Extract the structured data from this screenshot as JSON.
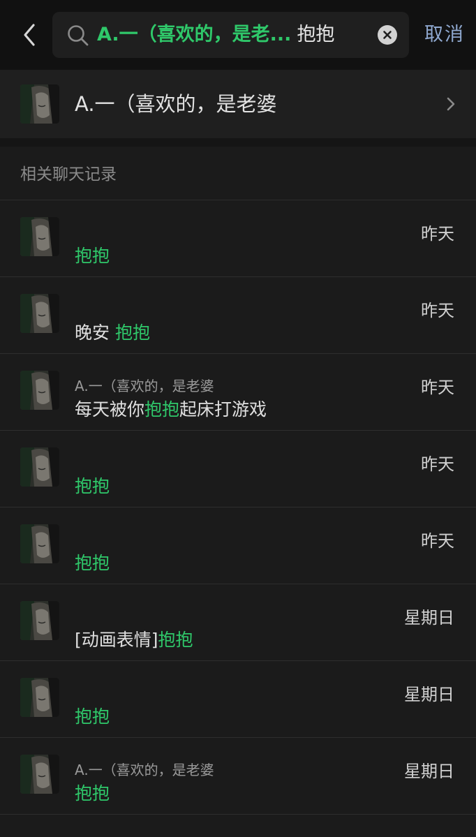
{
  "header": {
    "search_tag": "A.一（喜欢的，是老...",
    "search_term": "抱抱",
    "cancel_label": "取消"
  },
  "contact": {
    "name": "A.一（喜欢的，是老婆"
  },
  "section": {
    "title": "相关聊天记录"
  },
  "messages": [
    {
      "time": "昨天",
      "sender": "",
      "pre": "",
      "hl": "抱抱",
      "post": ""
    },
    {
      "time": "昨天",
      "sender": "",
      "pre": "晚安 ",
      "hl": "抱抱",
      "post": ""
    },
    {
      "time": "昨天",
      "sender": "A.一（喜欢的，是老婆",
      "pre": "每天被你",
      "hl": "抱抱",
      "post": "起床打游戏"
    },
    {
      "time": "昨天",
      "sender": "",
      "pre": "",
      "hl": "抱抱",
      "post": ""
    },
    {
      "time": "昨天",
      "sender": "",
      "pre": "",
      "hl": "抱抱",
      "post": ""
    },
    {
      "time": "星期日",
      "sender": "",
      "pre": "[动画表情]",
      "hl": "抱抱",
      "post": ""
    },
    {
      "time": "星期日",
      "sender": "",
      "pre": "",
      "hl": "抱抱",
      "post": ""
    },
    {
      "time": "星期日",
      "sender": "A.一（喜欢的，是老婆",
      "pre": "",
      "hl": "抱抱",
      "post": ""
    }
  ],
  "colors": {
    "highlight": "#2fc86a",
    "cancel": "#8fa8cf",
    "background": "#1b1b1b"
  },
  "icons": [
    "back-chevron-icon",
    "search-icon",
    "clear-icon",
    "chevron-right-icon"
  ]
}
